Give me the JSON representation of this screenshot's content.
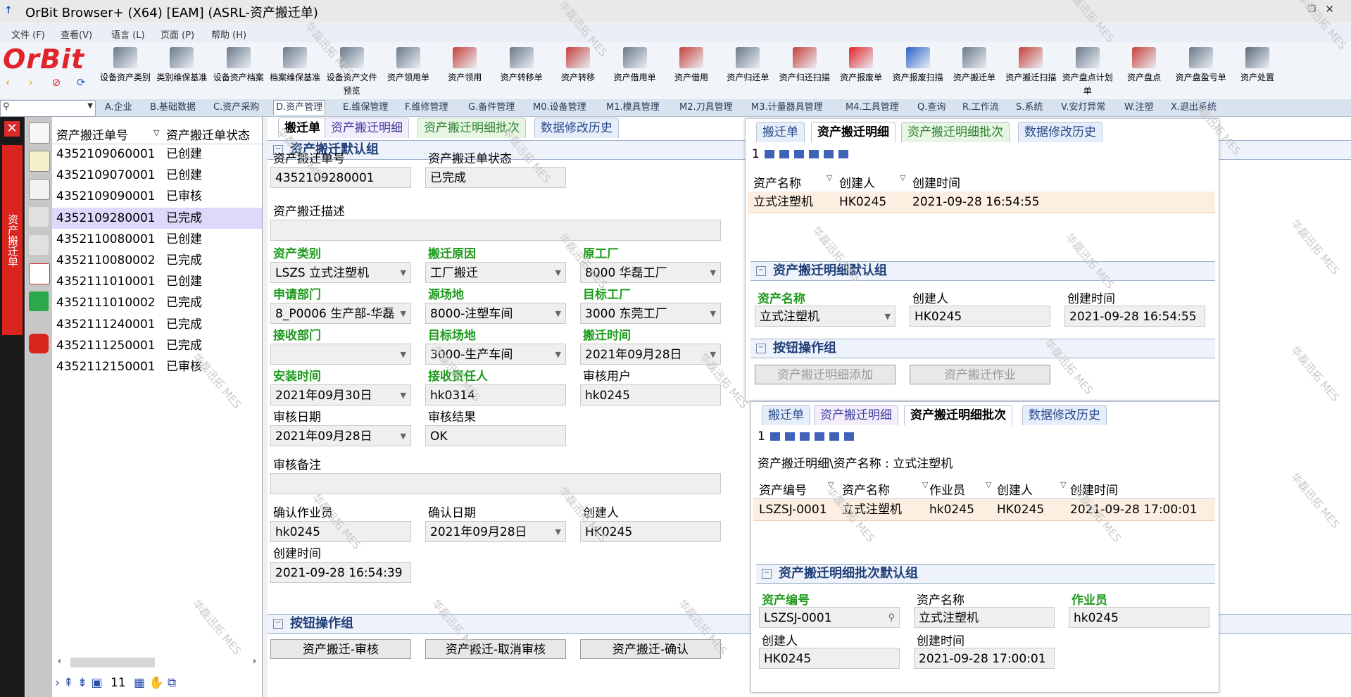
{
  "window": {
    "title": "OrBit Browser+ (X64) [EAM] (ASRL-资产搬迁单)"
  },
  "menu": [
    "文件 (F)",
    "查看(V)",
    "语言 (L)",
    "页面 (P)",
    "帮助 (H)"
  ],
  "logo": "OrBit",
  "toolbar": [
    "设备资产类别",
    "类别维保基准",
    "设备资产档案",
    "档案维保基准",
    "设备资产文件预览",
    "资产领用单",
    "资产领用",
    "资产转移单",
    "资产转移",
    "资产借用单",
    "资产借用",
    "资产归还单",
    "资产归还扫描",
    "资产报废单",
    "资产报废扫描",
    "资产搬迁单",
    "资产搬迁扫描",
    "资产盘点计划单",
    "资产盘点",
    "资产盘盈亏单",
    "资产处置"
  ],
  "navtabs": [
    "A.企业",
    "B.基础数据",
    "C.资产采购",
    "D.资产管理",
    "E.维保管理",
    "F.维修管理",
    "G.备件管理",
    "M0.设备管理",
    "M1.模具管理",
    "M2.刀具管理",
    "M3.计量器具管理",
    "M4.工具管理",
    "Q.查询",
    "R.工作流",
    "S.系统",
    "V.安灯异常",
    "W.注塑",
    "X.退出系统"
  ],
  "side_tab": "资产搬迁单",
  "list": {
    "col1": "资产搬迁单号",
    "col2": "资产搬迁单状态",
    "rows": [
      {
        "no": "4352109060001",
        "status": "已创建"
      },
      {
        "no": "4352109070001",
        "status": "已创建"
      },
      {
        "no": "4352109090001",
        "status": "已审核"
      },
      {
        "no": "4352109280001",
        "status": "已完成"
      },
      {
        "no": "4352110080001",
        "status": "已创建"
      },
      {
        "no": "4352110080002",
        "status": "已完成"
      },
      {
        "no": "4352111010001",
        "status": "已创建"
      },
      {
        "no": "4352111010002",
        "status": "已完成"
      },
      {
        "no": "4352111240001",
        "status": "已完成"
      },
      {
        "no": "4352111250001",
        "status": "已完成"
      },
      {
        "no": "4352112150001",
        "status": "已审核"
      }
    ],
    "count": "11"
  },
  "main": {
    "tabs": [
      "搬迁单",
      "资产搬迁明细",
      "资产搬迁明细批次",
      "数据修改历史"
    ],
    "group1": "资产搬迁默认组",
    "labels": {
      "no": "资产搬迁单号",
      "state": "资产搬迁单状态",
      "desc": "资产搬迁描述",
      "category": "资产类别",
      "reason": "搬迁原因",
      "src_factory": "原工厂",
      "apply_dept": "申请部门",
      "src_site": "源场地",
      "dst_factory": "目标工厂",
      "recv_dept": "接收部门",
      "dst_site": "目标场地",
      "move_time": "搬迁时间",
      "install_time": "安装时间",
      "receiver": "接收责任人",
      "audit_user": "审核用户",
      "audit_date": "审核日期",
      "audit_result": "审核结果",
      "audit_note": "审核备注",
      "confirm_op": "确认作业员",
      "confirm_date": "确认日期",
      "creator": "创建人",
      "created": "创建时间"
    },
    "values": {
      "no": "4352109280001",
      "state": "已完成",
      "desc": "",
      "category": "LSZS 立式注塑机",
      "reason": "工厂搬迁",
      "src_factory": "8000 华磊工厂",
      "apply_dept": "8_P0006 生产部-华磊",
      "src_site": "8000-注塑车间",
      "dst_factory": "3000 东莞工厂",
      "recv_dept": "",
      "dst_site": "3000-生产车间",
      "move_time": "2021年09月28日",
      "install_time": "2021年09月30日",
      "receiver": "hk0314",
      "audit_user": "hk0245",
      "audit_date": "2021年09月28日",
      "audit_result": "OK",
      "audit_note": "",
      "confirm_op": "hk0245",
      "confirm_date": "2021年09月28日",
      "creator": "HK0245",
      "created": "2021-09-28 16:54:39"
    },
    "group2": "按钮操作组",
    "buttons": [
      "资产搬迁-审核",
      "资产搬迁-取消审核",
      "资产搬迁-确认"
    ]
  },
  "detail": {
    "tabs": [
      "搬迁单",
      "资产搬迁明细",
      "资产搬迁明细批次",
      "数据修改历史"
    ],
    "page": "1",
    "cols": [
      "资产名称",
      "创建人",
      "创建时间"
    ],
    "row": [
      "立式注塑机",
      "HK0245",
      "2021-09-28 16:54:55"
    ],
    "group": "资产搬迁明细默认组",
    "labels": [
      "资产名称",
      "创建人",
      "创建时间"
    ],
    "values": [
      "立式注塑机",
      "HK0245",
      "2021-09-28 16:54:55"
    ],
    "btn_group": "按钮操作组",
    "buttons": [
      "资产搬迁明细添加",
      "资产搬迁作业"
    ]
  },
  "batch": {
    "tabs": [
      "搬迁单",
      "资产搬迁明细",
      "资产搬迁明细批次",
      "数据修改历史"
    ],
    "page": "1",
    "path": "资产搬迁明细\\资产名称 : 立式注塑机",
    "cols": [
      "资产编号",
      "资产名称",
      "作业员",
      "创建人",
      "创建时间"
    ],
    "row": [
      "LSZSJ-0001",
      "立式注塑机",
      "hk0245",
      "HK0245",
      "2021-09-28 17:00:01"
    ],
    "group": "资产搬迁明细批次默认组",
    "labels": [
      "资产编号",
      "资产名称",
      "作业员",
      "创建人",
      "创建时间"
    ],
    "values": [
      "LSZSJ-0001",
      "立式注塑机",
      "hk0245",
      "HK0245",
      "2021-09-28 17:00:01"
    ]
  },
  "watermark": "华磊迅拓 MES"
}
